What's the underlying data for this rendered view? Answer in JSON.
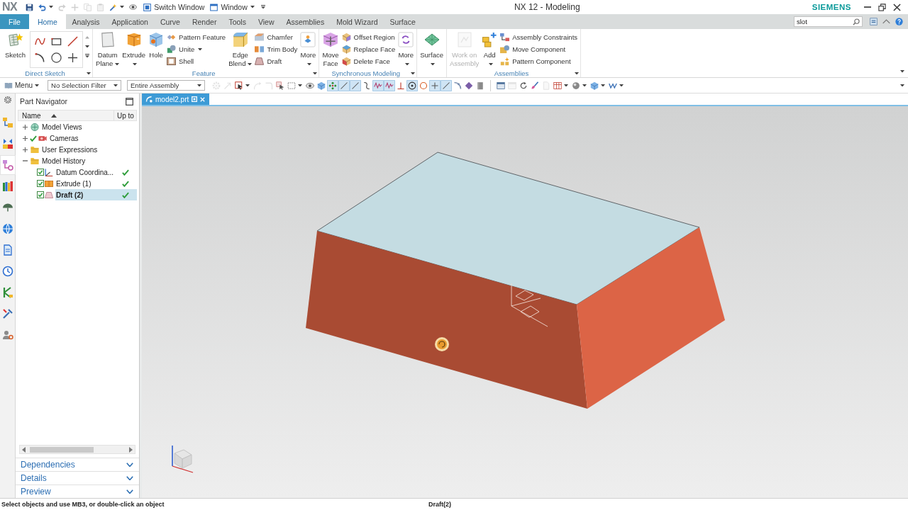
{
  "title_bar": {
    "logo": "NX",
    "quick_access": [
      {
        "disabled": false,
        "dropdown": false
      },
      {
        "disabled": false,
        "dropdown": true
      },
      {
        "disabled": true,
        "dropdown": false
      },
      {
        "disabled": true,
        "dropdown": false
      },
      {
        "disabled": true,
        "dropdown": false
      },
      {
        "disabled": true,
        "dropdown": false
      },
      {
        "disabled": false,
        "dropdown": true
      },
      {
        "disabled": false,
        "dropdown": false
      }
    ],
    "switch_window": "Switch Window",
    "window_menu": "Window",
    "title": "NX 12 - Modeling",
    "brand": "SIEMENS"
  },
  "ribbon": {
    "tabs": [
      {
        "label": "File",
        "kind": "file",
        "selected": false
      },
      {
        "label": "Home",
        "kind": "tab",
        "selected": true
      },
      {
        "label": "Analysis",
        "kind": "tab",
        "selected": false
      },
      {
        "label": "Application",
        "kind": "tab",
        "selected": false
      },
      {
        "label": "Curve",
        "kind": "tab",
        "selected": false
      },
      {
        "label": "Render",
        "kind": "tab",
        "selected": false
      },
      {
        "label": "Tools",
        "kind": "tab",
        "selected": false
      },
      {
        "label": "View",
        "kind": "tab",
        "selected": false
      },
      {
        "label": "Assemblies",
        "kind": "tab",
        "selected": false
      },
      {
        "label": "Mold Wizard",
        "kind": "tab",
        "selected": false
      },
      {
        "label": "Surface",
        "kind": "tab",
        "selected": false
      }
    ],
    "search": {
      "value": "slot"
    },
    "groups": [
      {
        "label": "Direct Sketch",
        "launcher": true,
        "items": [
          {
            "kind": "large",
            "label": "Sketch",
            "dropdown": false,
            "disabled": false
          },
          {
            "kind": "gallery"
          }
        ]
      },
      {
        "label": "Feature",
        "launcher": true,
        "items": [
          {
            "kind": "large",
            "label": "Datum Plane",
            "dropdown": true,
            "disabled": false
          },
          {
            "kind": "large",
            "label": "Extrude",
            "dropdown": true,
            "disabled": false
          },
          {
            "kind": "large",
            "label": "Hole",
            "dropdown": false,
            "disabled": false
          },
          {
            "kind": "stack",
            "commands": [
              {
                "label": "Pattern Feature",
                "dropdown": false
              },
              {
                "label": "Unite",
                "dropdown": true
              },
              {
                "label": "Shell",
                "dropdown": false
              }
            ]
          },
          {
            "kind": "large",
            "label": "Edge Blend",
            "dropdown": true,
            "disabled": false
          },
          {
            "kind": "stack",
            "commands": [
              {
                "label": "Chamfer",
                "dropdown": false
              },
              {
                "label": "Trim Body",
                "dropdown": false
              },
              {
                "label": "Draft",
                "dropdown": false
              }
            ]
          },
          {
            "kind": "large",
            "label": "More",
            "dropdown": true,
            "disabled": false
          }
        ]
      },
      {
        "label": "Synchronous Modeling",
        "launcher": true,
        "items": [
          {
            "kind": "large",
            "label": "Move Face",
            "dropdown": false,
            "disabled": false
          },
          {
            "kind": "stack",
            "commands": [
              {
                "label": "Offset Region",
                "dropdown": false
              },
              {
                "label": "Replace Face",
                "dropdown": false
              },
              {
                "label": "Delete Face",
                "dropdown": false
              }
            ]
          },
          {
            "kind": "large",
            "label": "More",
            "dropdown": true,
            "disabled": false
          }
        ]
      },
      {
        "launcher": false,
        "items": [
          {
            "kind": "large",
            "label": "Surface",
            "dropdown": true,
            "disabled": false
          }
        ]
      },
      {
        "label": "Assemblies",
        "launcher": true,
        "items": [
          {
            "kind": "large",
            "label": "Work on Assembly",
            "dropdown": false,
            "disabled": true
          },
          {
            "kind": "large",
            "label": "Add",
            "dropdown": true,
            "disabled": false
          },
          {
            "kind": "stack",
            "commands": [
              {
                "label": "Assembly Constraints",
                "dropdown": false
              },
              {
                "label": "Move Component",
                "dropdown": false
              },
              {
                "label": "Pattern Component",
                "dropdown": false
              }
            ]
          }
        ]
      }
    ]
  },
  "toolbar": {
    "menu": "Menu",
    "selection_filter": "No Selection Filter",
    "scope": "Entire Assembly",
    "button_groups": [
      {
        "buttons": [
          {
            "on": false,
            "disabled": true,
            "dropdown": false
          },
          {
            "on": false,
            "disabled": true,
            "dropdown": false
          },
          {
            "on": false,
            "disabled": false,
            "dropdown": true
          },
          {
            "on": false,
            "disabled": true,
            "dropdown": false
          },
          {
            "on": false,
            "disabled": true,
            "dropdown": false
          },
          {
            "on": false,
            "disabled": false,
            "dropdown": false
          },
          {
            "on": false,
            "disabled": false,
            "dropdown": true
          },
          {
            "on": false,
            "disabled": false,
            "dropdown": false
          },
          {
            "on": false,
            "disabled": false,
            "dropdown": false
          },
          {
            "on": true,
            "disabled": false,
            "dropdown": false
          },
          {
            "on": true,
            "disabled": false,
            "dropdown": false
          },
          {
            "on": true,
            "disabled": false,
            "dropdown": false
          },
          {
            "on": false,
            "disabled": false,
            "dropdown": false
          },
          {
            "on": true,
            "disabled": false,
            "dropdown": false
          },
          {
            "on": true,
            "disabled": false,
            "dropdown": false
          },
          {
            "on": false,
            "disabled": false,
            "dropdown": false
          },
          {
            "on": true,
            "disabled": false,
            "dropdown": false
          },
          {
            "on": false,
            "disabled": false,
            "dropdown": false
          },
          {
            "on": true,
            "disabled": false,
            "dropdown": false
          },
          {
            "on": true,
            "disabled": false,
            "dropdown": false
          },
          {
            "on": false,
            "disabled": false,
            "dropdown": false
          },
          {
            "on": false,
            "disabled": false,
            "dropdown": false
          },
          {
            "on": false,
            "disabled": false,
            "dropdown": false
          }
        ]
      },
      {
        "buttons": [
          {
            "on": false,
            "disabled": false,
            "dropdown": false
          },
          {
            "on": false,
            "disabled": true,
            "dropdown": false
          },
          {
            "on": false,
            "disabled": false,
            "dropdown": false
          },
          {
            "on": false,
            "disabled": false,
            "dropdown": false
          },
          {
            "on": false,
            "disabled": true,
            "dropdown": false
          },
          {
            "on": false,
            "disabled": false,
            "dropdown": true
          },
          {
            "on": false,
            "disabled": false,
            "dropdown": true
          },
          {
            "on": false,
            "disabled": false,
            "dropdown": true
          },
          {
            "on": false,
            "disabled": false,
            "dropdown": true
          }
        ]
      }
    ]
  },
  "resource_bar": [
    {
      "selected": false
    },
    {
      "selected": false
    },
    {
      "selected": true
    },
    {
      "selected": false
    },
    {
      "selected": false
    },
    {
      "selected": false
    },
    {
      "selected": false
    },
    {
      "selected": false
    },
    {
      "selected": false
    },
    {
      "selected": false
    },
    {
      "selected": false
    }
  ],
  "part_navigator": {
    "title": "Part Navigator",
    "columns": [
      "Name",
      "Up to"
    ],
    "nodes": [
      {
        "label": "Model Views",
        "expanded": false,
        "active": false,
        "selected": false
      },
      {
        "label": "Cameras",
        "expanded": false,
        "active": true,
        "selected": false
      },
      {
        "label": "User Expressions",
        "expanded": false,
        "active": false,
        "selected": false
      },
      {
        "label": "Model History",
        "expanded": true,
        "active": false,
        "selected": false,
        "children": [
          {
            "label": "Datum Coordina...",
            "checked": true,
            "up_to_date": true,
            "selected": false
          },
          {
            "label": "Extrude (1)",
            "checked": true,
            "up_to_date": true,
            "selected": false
          },
          {
            "label": "Draft (2)",
            "checked": true,
            "up_to_date": true,
            "selected": true
          }
        ]
      }
    ],
    "panels": [
      {
        "label": "Dependencies",
        "expanded": false
      },
      {
        "label": "Details",
        "expanded": false
      },
      {
        "label": "Preview",
        "expanded": false
      }
    ]
  },
  "graphics": {
    "tabs": [
      {
        "label": "model2.prt",
        "selected": true
      }
    ]
  },
  "status_bar": {
    "prompt": "Select objects and use MB3, or double-click an object",
    "status": "Draft(2)"
  }
}
